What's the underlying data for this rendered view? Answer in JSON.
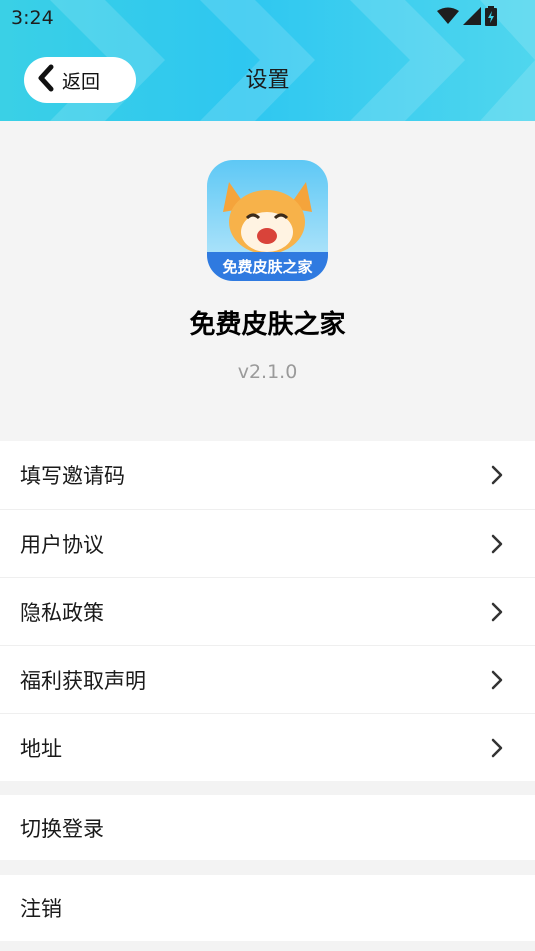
{
  "status": {
    "time": "3:24",
    "icons": [
      "wifi-icon",
      "signal-icon",
      "battery-charging-icon"
    ]
  },
  "header": {
    "back_label": "返回",
    "title": "设置"
  },
  "app": {
    "name": "免费皮肤之家",
    "version": "v2.1.0",
    "icon_text": "免费皮肤之家"
  },
  "menu": {
    "items": [
      {
        "label": "填写邀请码"
      },
      {
        "label": "用户协议"
      },
      {
        "label": "隐私政策"
      },
      {
        "label": "福利获取声明"
      },
      {
        "label": "地址"
      }
    ],
    "switch_login": "切换登录",
    "logout": "注销"
  },
  "colors": {
    "header_start": "#3ad0e6",
    "header_end": "#4fd6ee",
    "background": "#f3f3f3",
    "version_text": "#9a9a9a"
  }
}
